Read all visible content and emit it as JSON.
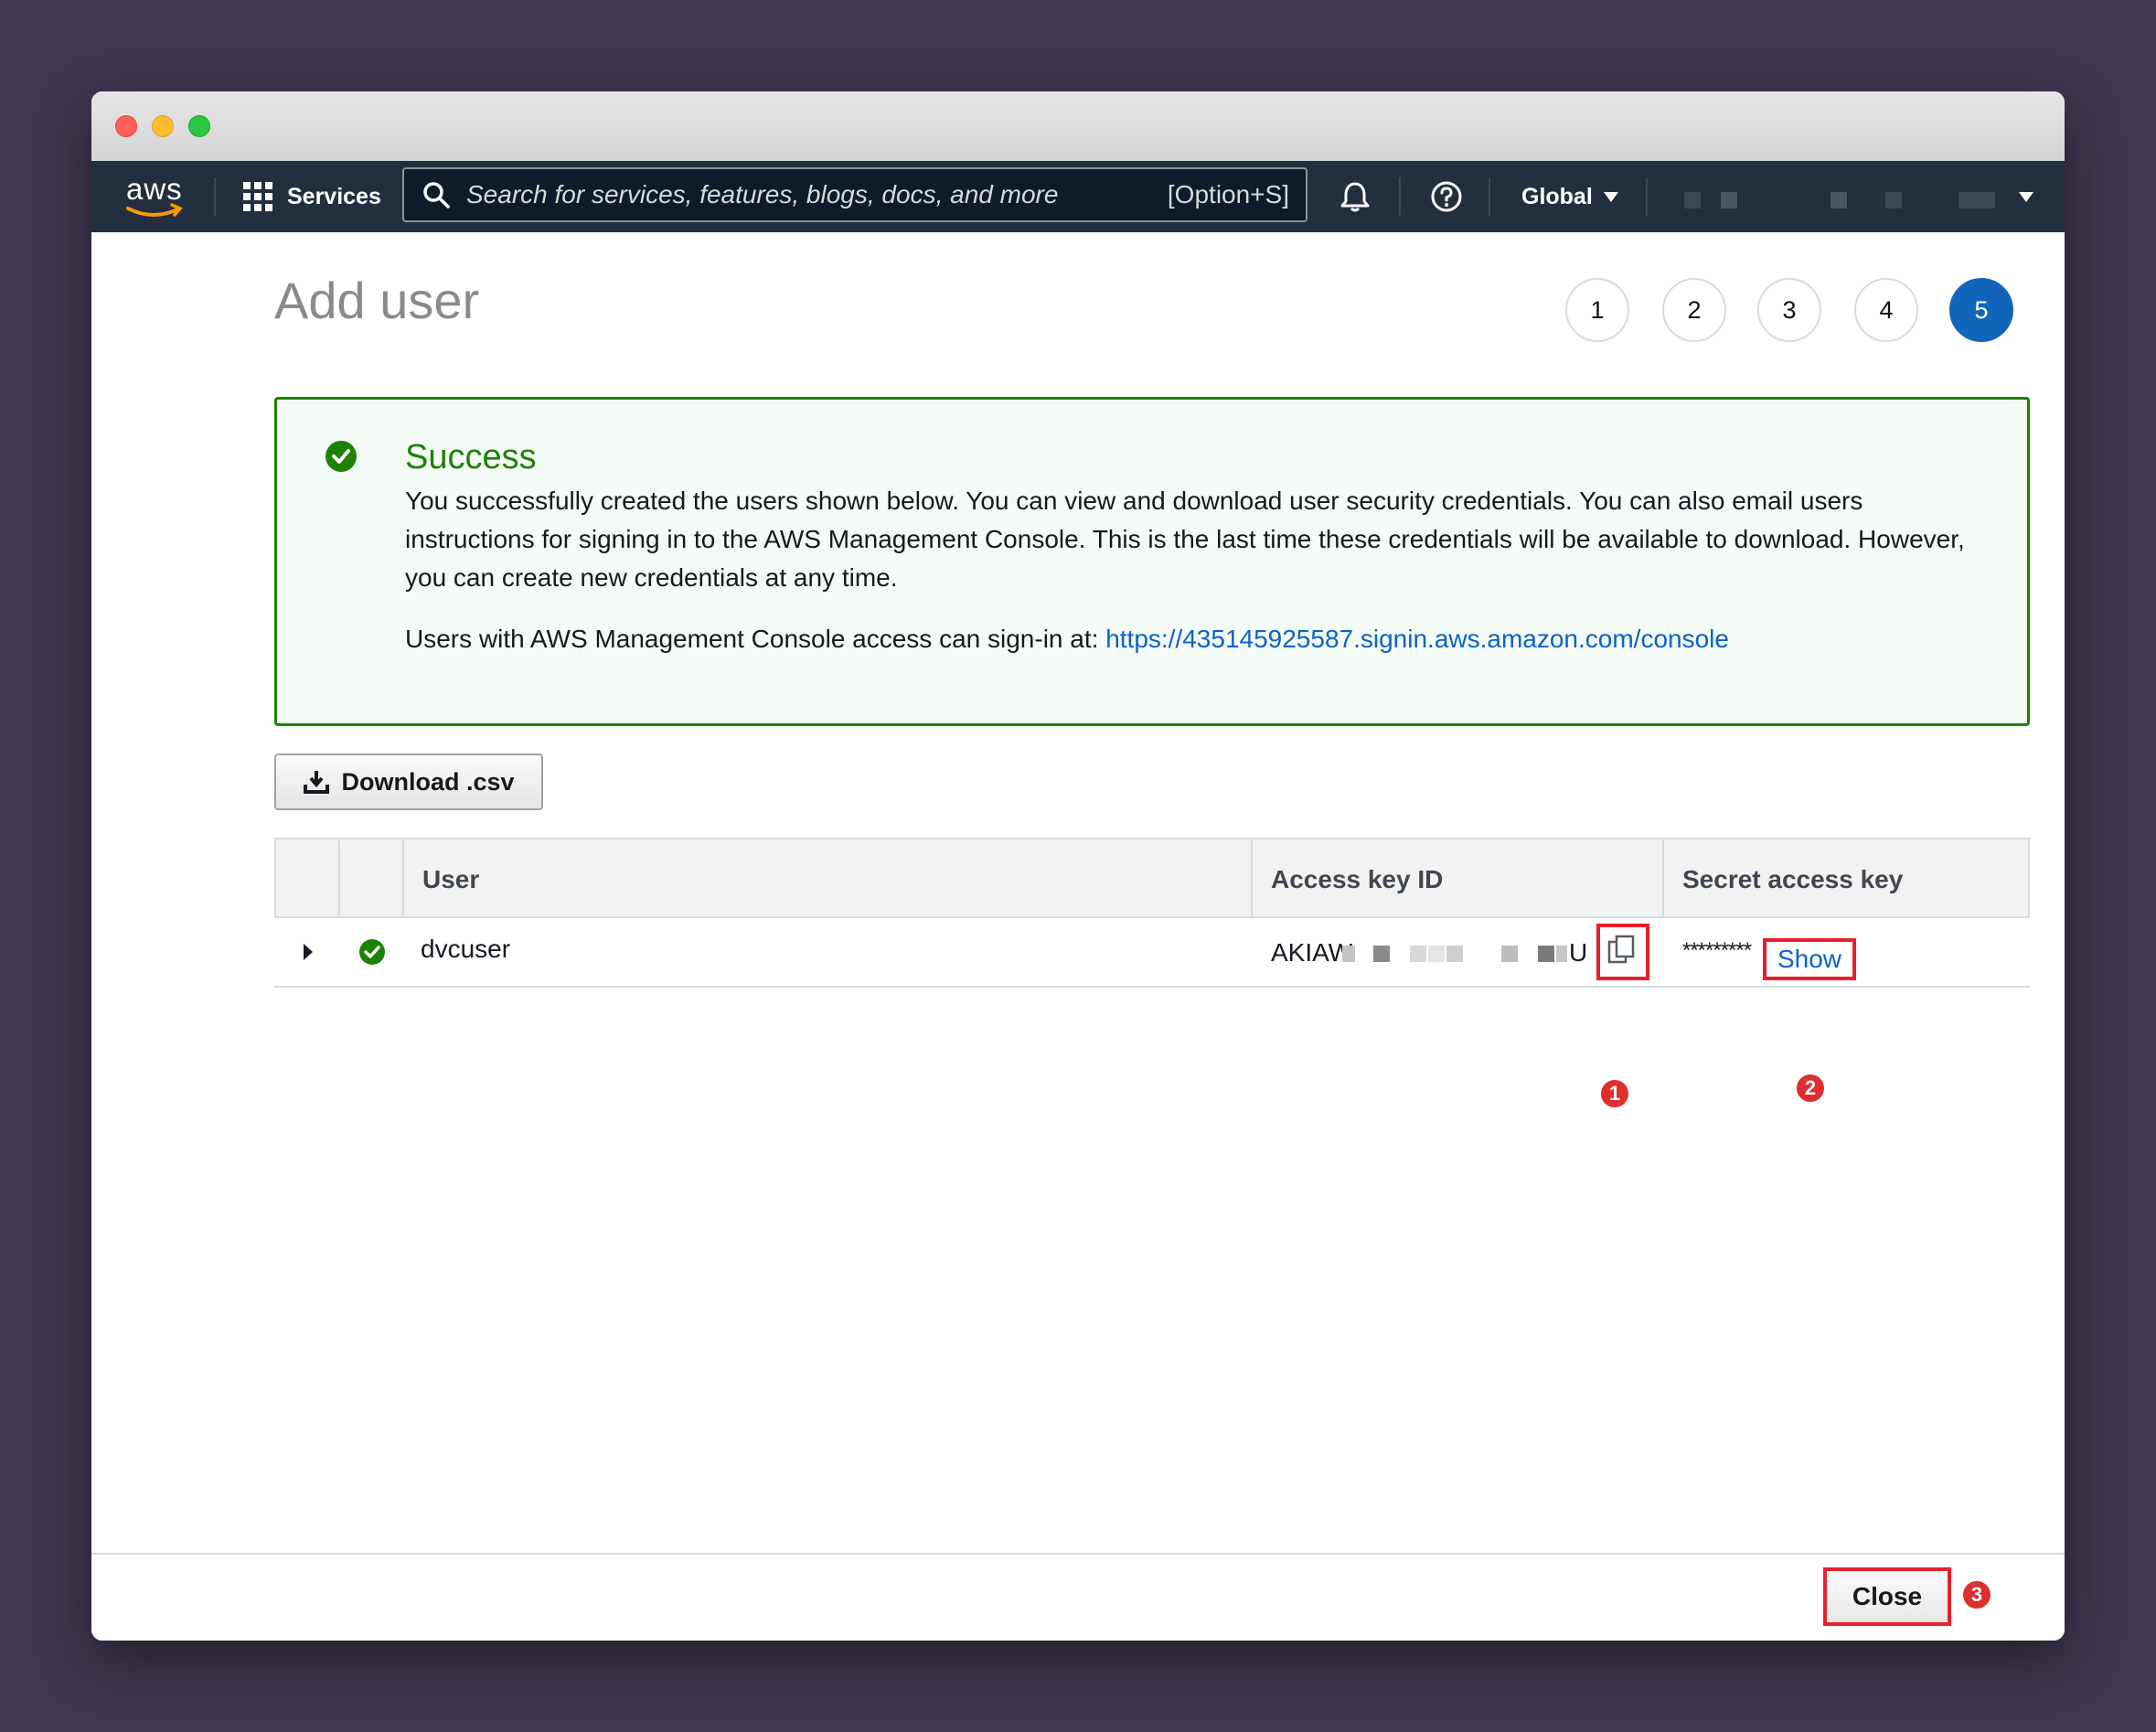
{
  "navbar": {
    "logo_text": "aws",
    "services_label": "Services",
    "search_placeholder": "Search for services, features, blogs, docs, and more",
    "search_shortcut": "[Option+S]",
    "region_label": "Global"
  },
  "page": {
    "title": "Add user",
    "steps": [
      "1",
      "2",
      "3",
      "4",
      "5"
    ],
    "active_step": "5"
  },
  "alert": {
    "title": "Success",
    "message": "You successfully created the users shown below. You can view and download user security credentials. You can also email users instructions for signing in to the AWS Management Console. This is the last time these credentials will be available to download. However, you can create new credentials at any time.",
    "signin_prefix": "Users with AWS Management Console access can sign-in at: ",
    "signin_url": "https://435145925587.signin.aws.amazon.com/console",
    "color": "#1d8102"
  },
  "download_button_label": "Download .csv",
  "table": {
    "headers": [
      "User",
      "Access key ID",
      "Secret access key"
    ],
    "rows": [
      {
        "user": "dvcuser",
        "access_key_prefix": "AKIAW",
        "access_key_suffix": "U",
        "secret_mask": "*********",
        "show_label": "Show"
      }
    ]
  },
  "annotations": [
    "1",
    "2",
    "3"
  ],
  "footer": {
    "close_label": "Close"
  },
  "colors": {
    "navbar_bg": "#232f3e",
    "accent_blue": "#1166bb",
    "link_blue": "#0b63c4",
    "annotation_red": "#e02d2d"
  }
}
